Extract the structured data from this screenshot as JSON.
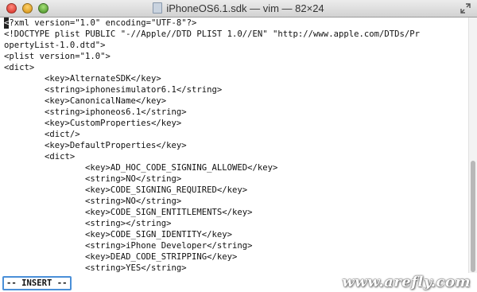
{
  "window": {
    "title": "iPhoneOS6.1.sdk — vim — 82×24",
    "icons": [
      "close-button",
      "minimize-button",
      "zoom-button",
      "document-icon",
      "fullscreen-icon"
    ]
  },
  "editor": {
    "cursor_char": "<",
    "first_line_rest": "?xml version=\"1.0\" encoding=\"UTF-8\"?>",
    "lines": [
      "<!DOCTYPE plist PUBLIC \"-//Apple//DTD PLIST 1.0//EN\" \"http://www.apple.com/DTDs/Pr",
      "opertyList-1.0.dtd\">",
      "<plist version=\"1.0\">",
      "<dict>",
      "        <key>AlternateSDK</key>",
      "        <string>iphonesimulator6.1</string>",
      "        <key>CanonicalName</key>",
      "        <string>iphoneos6.1</string>",
      "        <key>CustomProperties</key>",
      "        <dict/>",
      "        <key>DefaultProperties</key>",
      "        <dict>",
      "                <key>AD_HOC_CODE_SIGNING_ALLOWED</key>",
      "                <string>NO</string>",
      "                <key>CODE_SIGNING_REQUIRED</key>",
      "                <string>NO</string>",
      "                <key>CODE_SIGN_ENTITLEMENTS</key>",
      "                <string></string>",
      "                <key>CODE_SIGN_IDENTITY</key>",
      "                <string>iPhone Developer</string>",
      "                <key>DEAD_CODE_STRIPPING</key>",
      "                <string>YES</string>"
    ]
  },
  "status": {
    "mode": "-- INSERT --"
  },
  "watermark": "www.arefly.com"
}
